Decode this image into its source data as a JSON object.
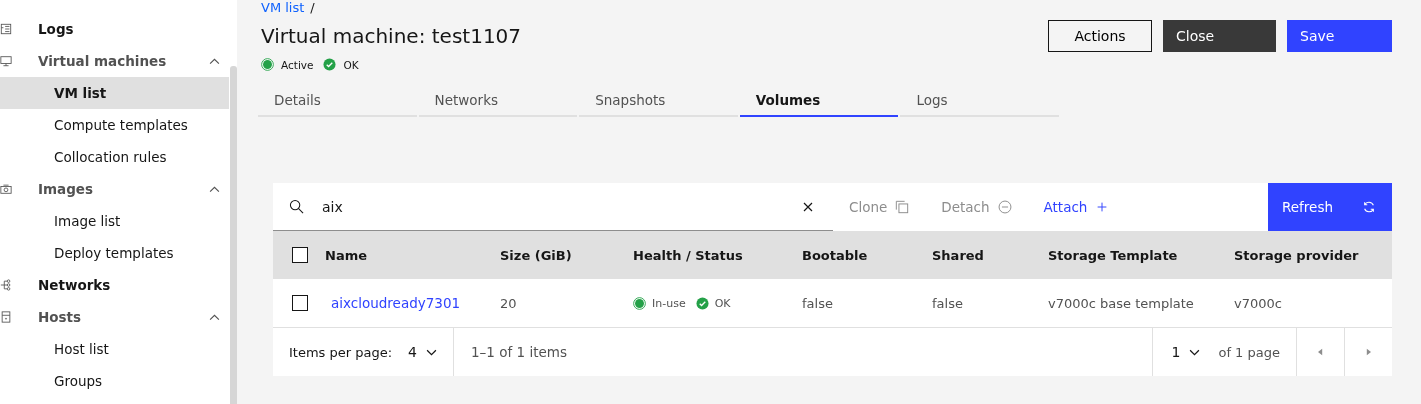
{
  "sidebar": {
    "items": [
      {
        "label": "Logs",
        "kind": "link"
      },
      {
        "label": "Virtual machines",
        "kind": "group",
        "expanded": true,
        "children": [
          {
            "label": "VM list",
            "selected": true
          },
          {
            "label": "Compute templates",
            "selected": false
          },
          {
            "label": "Collocation rules",
            "selected": false
          }
        ]
      },
      {
        "label": "Images",
        "kind": "group",
        "expanded": true,
        "children": [
          {
            "label": "Image list",
            "selected": false
          },
          {
            "label": "Deploy templates",
            "selected": false
          }
        ]
      },
      {
        "label": "Networks",
        "kind": "link"
      },
      {
        "label": "Hosts",
        "kind": "group",
        "expanded": true,
        "children": [
          {
            "label": "Host list",
            "selected": false
          },
          {
            "label": "Groups",
            "selected": false
          }
        ]
      }
    ]
  },
  "breadcrumb": {
    "link": "VM list",
    "separator": "/"
  },
  "title": "Virtual machine: test1107",
  "statuses": [
    {
      "kind": "state",
      "label": "Active",
      "color": "#24a148"
    },
    {
      "kind": "health",
      "label": "OK",
      "color": "#24a148"
    }
  ],
  "actions": [
    {
      "label": "Actions",
      "kind": "tertiary"
    },
    {
      "label": "Close",
      "kind": "secondary"
    },
    {
      "label": "Save",
      "kind": "primary"
    }
  ],
  "tabs": [
    {
      "label": "Details",
      "selected": false
    },
    {
      "label": "Networks",
      "selected": false
    },
    {
      "label": "Snapshots",
      "selected": false
    },
    {
      "label": "Volumes",
      "selected": true
    },
    {
      "label": "Logs",
      "selected": false
    }
  ],
  "toolbar": {
    "search": {
      "value": "aix"
    },
    "buttons": [
      {
        "label": "Clone",
        "disabled": true
      },
      {
        "label": "Detach",
        "disabled": true
      },
      {
        "label": "Attach",
        "disabled": false
      }
    ],
    "primary": {
      "label": "Refresh"
    }
  },
  "table": {
    "columns": [
      "Name",
      "Size (GiB)",
      "Health / Status",
      "Bootable",
      "Shared",
      "Storage Template",
      "Storage provider"
    ],
    "rows": [
      {
        "checked": false,
        "name": "aixcloudready7301",
        "size": "20",
        "state": {
          "label": "In-use",
          "color": "#24a148"
        },
        "health": {
          "label": "OK",
          "color": "#24a148"
        },
        "bootable": "false",
        "shared": "false",
        "template": "v7000c base template",
        "provider": "v7000c"
      }
    ],
    "header_checked": false
  },
  "pagination": {
    "items_per_page_label": "Items per page:",
    "items_per_page": "4",
    "range": "1–1 of 1 items",
    "page": "1",
    "page_total": "of 1 page"
  }
}
